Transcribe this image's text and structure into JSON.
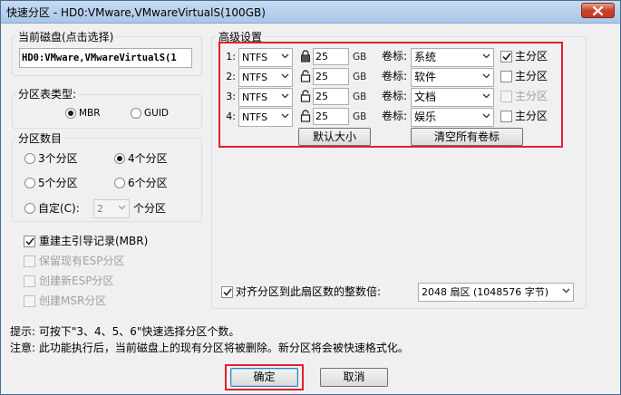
{
  "window": {
    "title": "快速分区 - HD0:VMware,VMwareVirtualS(100GB)"
  },
  "current_disk": {
    "legend": "当前磁盘(点击选择)",
    "value": "HD0:VMware,VMwareVirtualS(1"
  },
  "partition_table": {
    "legend": "分区表类型:",
    "options": [
      "MBR",
      "GUID"
    ],
    "selected": "MBR"
  },
  "partition_count": {
    "legend": "分区数目",
    "options": [
      "3个分区",
      "4个分区",
      "5个分区",
      "6个分区"
    ],
    "selected": "4个分区",
    "custom_label": "自定(C):",
    "custom_value": "2",
    "custom_unit": "个分区"
  },
  "checkboxes": [
    {
      "label": "重建主引导记录(MBR)",
      "checked": true,
      "enabled": true
    },
    {
      "label": "保留现有ESP分区",
      "checked": false,
      "enabled": false
    },
    {
      "label": "创建新ESP分区",
      "checked": false,
      "enabled": false
    },
    {
      "label": "创建MSR分区",
      "checked": false,
      "enabled": false
    }
  ],
  "advanced": {
    "legend": "高级设置",
    "size_unit": "GB",
    "volume_label_caption": "卷标:",
    "primary_label": "主分区",
    "rows": [
      {
        "num": "1:",
        "fs": "NTFS",
        "size": "25",
        "locked": true,
        "volume": "系统",
        "primary": true,
        "primary_enabled": true
      },
      {
        "num": "2:",
        "fs": "NTFS",
        "size": "25",
        "locked": false,
        "volume": "软件",
        "primary": false,
        "primary_enabled": true
      },
      {
        "num": "3:",
        "fs": "NTFS",
        "size": "25",
        "locked": false,
        "volume": "文档",
        "primary": false,
        "primary_enabled": false
      },
      {
        "num": "4:",
        "fs": "NTFS",
        "size": "25",
        "locked": false,
        "volume": "娱乐",
        "primary": false,
        "primary_enabled": true
      }
    ],
    "default_size_button": "默认大小",
    "clear_labels_button": "清空所有卷标"
  },
  "align": {
    "label": "对齐分区到此扇区数的整数倍:",
    "checked": true,
    "value": "2048 扇区 (1048576 字节)"
  },
  "hints": {
    "tip": "提示: 可按下\"3、4、5、6\"快速选择分区个数。",
    "note": "注意: 此功能执行后，当前磁盘上的现有分区将被删除。新分区将会被快速格式化。"
  },
  "buttons": {
    "ok": "确定",
    "cancel": "取消"
  },
  "colors": {
    "highlight_frame": "#e3202f",
    "close_button": "#c53c22"
  },
  "icons": {
    "lock_closed": "lock-icon",
    "lock_open": "unlock-icon",
    "dropdown": "chevron-down-icon",
    "close": "close-icon"
  }
}
